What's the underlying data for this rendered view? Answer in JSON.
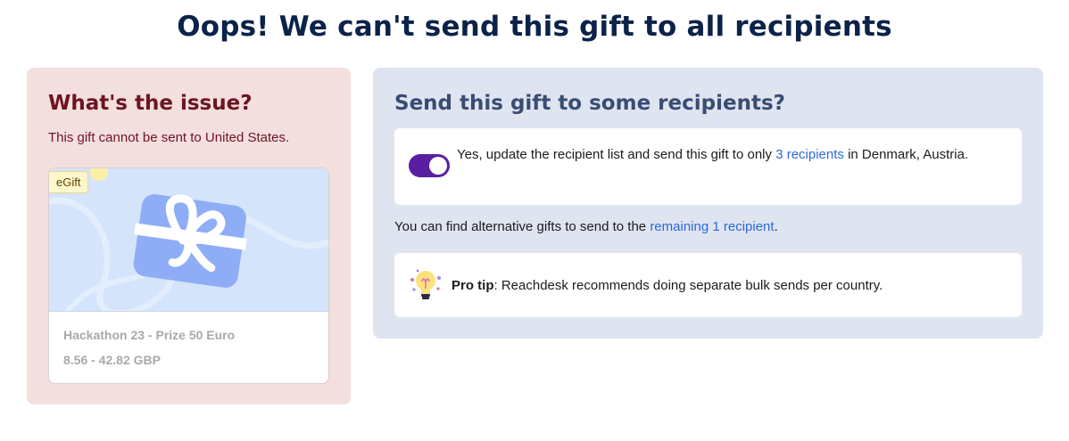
{
  "page": {
    "title": "Oops! We can't send this gift to all recipients"
  },
  "issue": {
    "heading": "What's the issue?",
    "description": "This gift cannot be sent to United States.",
    "gift": {
      "badge": "eGift",
      "name": "Hackathon 23 - Prize 50 Euro",
      "price": "8.56 - 42.82 GBP"
    }
  },
  "send": {
    "heading": "Send this gift to some recipients?",
    "toggle": {
      "on": true,
      "text_before": "Yes, update the recipient list and send this gift to only ",
      "link": "3 recipients",
      "text_after": " in Denmark, Austria."
    },
    "alternative": {
      "text_before": "You can find alternative gifts to send to the ",
      "link": "remaining 1 recipient",
      "text_after": "."
    },
    "tip": {
      "label": "Pro tip",
      "text": ": Reachdesk recommends doing separate bulk sends per country."
    }
  },
  "colors": {
    "title": "#0b2349",
    "issue_bg": "#f3dfde",
    "send_bg": "#dfe4f1",
    "toggle_on": "#5a1fa0",
    "link": "#2c6ad8"
  },
  "icons": [
    "gift-icon",
    "lightbulb-icon"
  ]
}
